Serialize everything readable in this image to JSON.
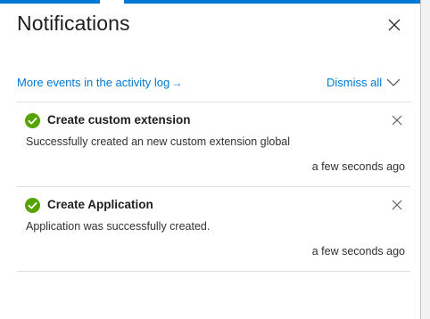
{
  "panel": {
    "title": "Notifications",
    "close_icon": "close-icon"
  },
  "actions": {
    "activity_log_link": "More events in the activity log",
    "activity_log_arrow": "→",
    "dismiss_all": "Dismiss all",
    "dismiss_menu_icon": "chevron-down-icon"
  },
  "notifications": [
    {
      "title": "Create custom extension",
      "message": "Successfully created an new custom extension global",
      "time": "a few seconds ago",
      "status": "success"
    },
    {
      "title": "Create Application",
      "message": "Application was successfully created.",
      "time": "a few seconds ago",
      "status": "success"
    }
  ],
  "colors": {
    "accent": "#0078d4",
    "success": "#57a300",
    "divider": "#e1dfdd"
  }
}
